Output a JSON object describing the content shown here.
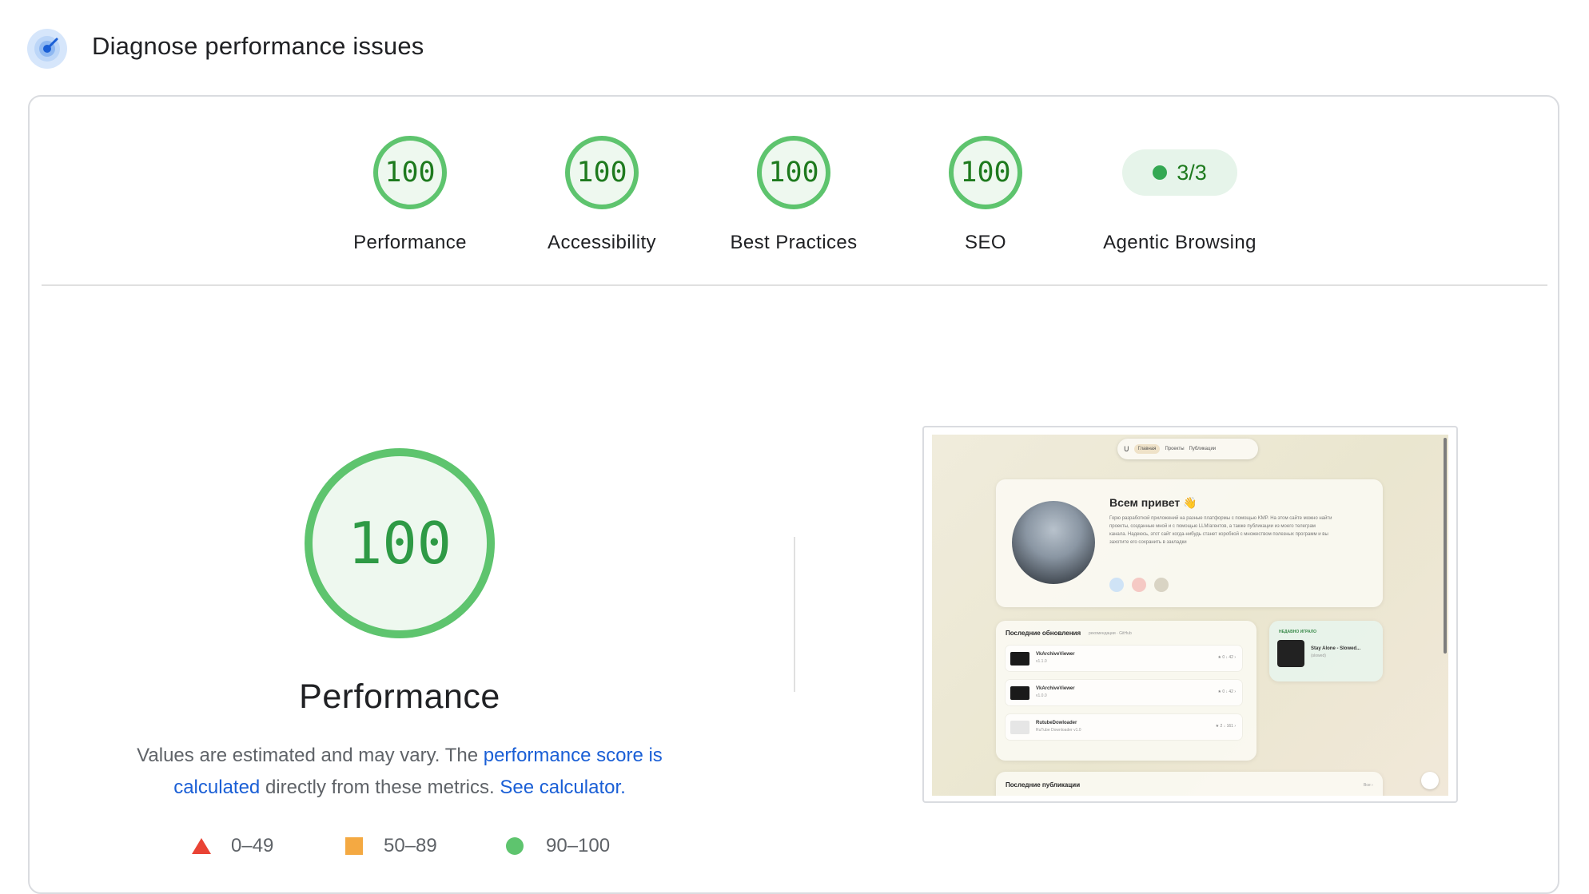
{
  "header": {
    "title": "Diagnose performance issues",
    "icon": "lighthouse-icon"
  },
  "gauges": [
    {
      "score": "100",
      "label": "Performance"
    },
    {
      "score": "100",
      "label": "Accessibility"
    },
    {
      "score": "100",
      "label": "Best Practices"
    },
    {
      "score": "100",
      "label": "SEO"
    }
  ],
  "agentic": {
    "value": "3/3",
    "label": "Agentic Browsing"
  },
  "main": {
    "score": "100",
    "label": "Performance",
    "desc_prefix": "Values are estimated and may vary. The ",
    "desc_link": "performance score is calculated",
    "desc_middle": " directly from these metrics. ",
    "desc_calc": "See calculator.",
    "legend": [
      {
        "range": "0–49",
        "shape": "triangle",
        "color": "#e94335"
      },
      {
        "range": "50–89",
        "shape": "square",
        "color": "#f4a942"
      },
      {
        "range": "90–100",
        "shape": "circle",
        "color": "#5ec46e"
      }
    ]
  },
  "colors": {
    "pass_ring": "#5ec46e",
    "pass_fill": "#eef8ef",
    "pass_text": "#1e7a1e",
    "link": "#1a5fd6"
  },
  "screenshot": {
    "nav": [
      "Главная",
      "Проекты",
      "Публикации"
    ],
    "hello_title": "Всем привет 👋",
    "hello_text": "Горю разработкой приложений на разные платформы с помощью KMP. На этом сайте можно найти проекты, созданные мной и с помощью LLM/агентов, а также публикации из моего телеграм канала. Надеюсь, этот сайт когда-нибудь станет коробкой с множеством полезных программ и вы захотите его сохранить в закладки",
    "updates_title": "Последние обновления",
    "updates_sub": "рекомендации · GitHub",
    "updates": [
      {
        "name": "VkArchiveViewer",
        "version": "v1.1.0",
        "meta": "★ 0  ↓ 42  ›"
      },
      {
        "name": "VkArchiveViewer",
        "version": "v1.0.0",
        "meta": "★ 0  ↓ 42  ›"
      },
      {
        "name": "RutubeDowloader",
        "version": "RuTube Downloader v1.0",
        "meta": "★ 2  ↓ 161  ›"
      }
    ],
    "played_title": "НЕДАВНО ИГРАЛО",
    "played_track": "Stay Alone - Slowed...",
    "played_artist": "(slowed)",
    "pubs_title": "Последние публикации",
    "pubs_more": "Все ›"
  }
}
